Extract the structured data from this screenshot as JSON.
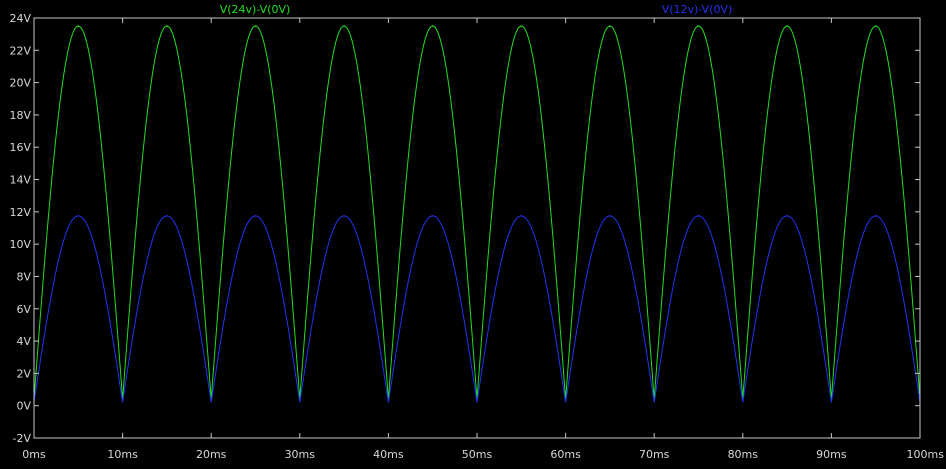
{
  "chart_data": {
    "type": "line",
    "title": "",
    "xlabel": "",
    "ylabel": "",
    "xlim": [
      0,
      100
    ],
    "ylim": [
      -2,
      24
    ],
    "x_ticks": [
      {
        "value": 0,
        "label": "0ms"
      },
      {
        "value": 10,
        "label": "10ms"
      },
      {
        "value": 20,
        "label": "20ms"
      },
      {
        "value": 30,
        "label": "30ms"
      },
      {
        "value": 40,
        "label": "40ms"
      },
      {
        "value": 50,
        "label": "50ms"
      },
      {
        "value": 60,
        "label": "60ms"
      },
      {
        "value": 70,
        "label": "70ms"
      },
      {
        "value": 80,
        "label": "80ms"
      },
      {
        "value": 90,
        "label": "90ms"
      },
      {
        "value": 100,
        "label": "100ms"
      }
    ],
    "y_ticks": [
      {
        "value": -2,
        "label": "-2V"
      },
      {
        "value": 0,
        "label": "0V"
      },
      {
        "value": 2,
        "label": "2V"
      },
      {
        "value": 4,
        "label": "4V"
      },
      {
        "value": 6,
        "label": "6V"
      },
      {
        "value": 8,
        "label": "8V"
      },
      {
        "value": 10,
        "label": "10V"
      },
      {
        "value": 12,
        "label": "12V"
      },
      {
        "value": 14,
        "label": "14V"
      },
      {
        "value": 16,
        "label": "16V"
      },
      {
        "value": 18,
        "label": "18V"
      },
      {
        "value": 20,
        "label": "20V"
      },
      {
        "value": 22,
        "label": "22V"
      },
      {
        "value": 24,
        "label": "24V"
      }
    ],
    "grid": false,
    "legend_position": "top",
    "series": [
      {
        "name": "V(24v)-V(0V)",
        "color": "#22dd22",
        "waveform": "full-wave rectified sine",
        "peak": 23.5,
        "valley": 0.4,
        "period_ms": 10,
        "peak_times_ms": [
          5,
          15,
          25,
          35,
          45,
          55,
          65,
          75,
          85,
          95
        ]
      },
      {
        "name": "V(12v)-V(0V)",
        "color": "#2233ee",
        "waveform": "full-wave rectified sine",
        "peak": 11.75,
        "valley": 0.2,
        "period_ms": 10,
        "peak_times_ms": [
          5,
          15,
          25,
          35,
          45,
          55,
          65,
          75,
          85,
          95
        ]
      }
    ],
    "frame_color": "#c8c8c8",
    "background": "#000000"
  }
}
